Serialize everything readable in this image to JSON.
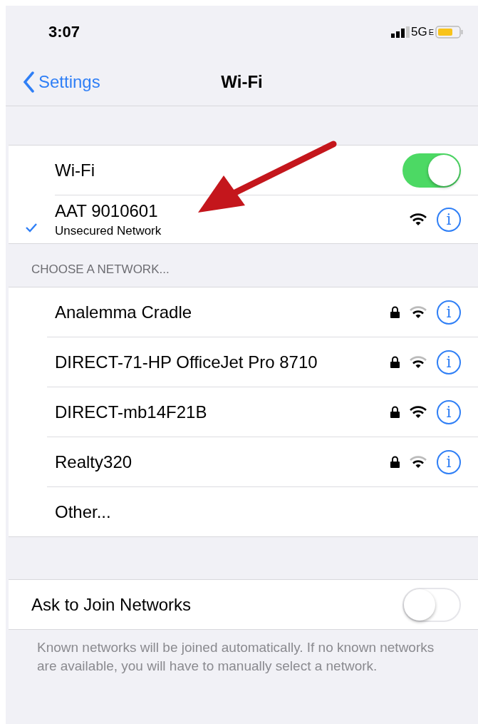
{
  "status_bar": {
    "time": "3:07",
    "network": "5G",
    "network_suffix": "E"
  },
  "nav": {
    "back": "Settings",
    "title": "Wi-Fi"
  },
  "wifi": {
    "label": "Wi-Fi",
    "on": true
  },
  "connected": {
    "name": "AAT 9010601",
    "subtitle": "Unsecured Network",
    "full_signal": true,
    "info": "i"
  },
  "section_header": "CHOOSE A NETWORK...",
  "networks": [
    {
      "name": "Analemma Cradle",
      "locked": true,
      "full_signal": false,
      "info": "i"
    },
    {
      "name": "DIRECT-71-HP OfficeJet Pro 8710",
      "locked": true,
      "full_signal": false,
      "info": "i"
    },
    {
      "name": "DIRECT-mb14F21B",
      "locked": true,
      "full_signal": true,
      "info": "i"
    },
    {
      "name": "Realty320",
      "locked": true,
      "full_signal": false,
      "info": "i"
    }
  ],
  "other": "Other...",
  "ask_to_join": {
    "label": "Ask to Join Networks",
    "on": false
  },
  "footer": "Known networks will be joined automatically. If no known networks are available, you will have to manually select a network."
}
